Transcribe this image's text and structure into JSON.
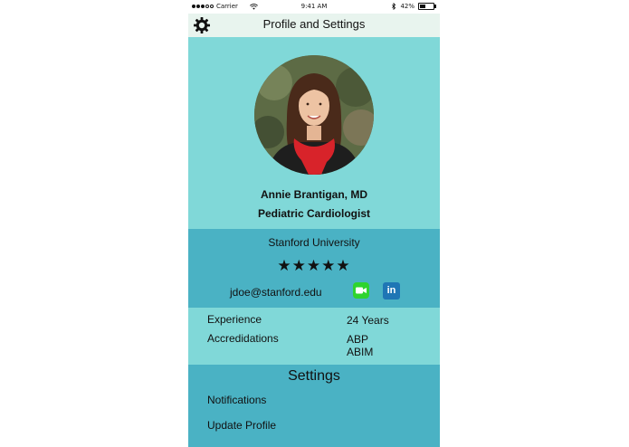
{
  "status_bar": {
    "carrier": "Carrier",
    "time": "9:41 AM",
    "battery_percent": "42%",
    "battery_level": 0.42
  },
  "header": {
    "title": "Profile and Settings",
    "menu_icon": "gear-icon"
  },
  "profile": {
    "name": "Annie Brantigan, MD",
    "specialty": "Pediatric Cardiologist"
  },
  "contact": {
    "school": "Stanford University",
    "rating_display": "★★★★★",
    "rating": 5,
    "email": "jdoe@stanford.edu",
    "linkedin_label": "in",
    "colors": {
      "facetime": "#2fd42f",
      "linkedin": "#1f76b5"
    }
  },
  "details": {
    "experience_label": "Experience",
    "experience_value": "24 Years",
    "accreditations_label": "Accredidations",
    "accreditations": [
      "ABP",
      "ABIM"
    ]
  },
  "settings": {
    "heading": "Settings",
    "items": [
      "Notifications",
      "Update Profile"
    ]
  },
  "colors": {
    "header_bg": "#e8f4ee",
    "light_teal": "#80d8d8",
    "dark_teal": "#4ab2c4"
  }
}
